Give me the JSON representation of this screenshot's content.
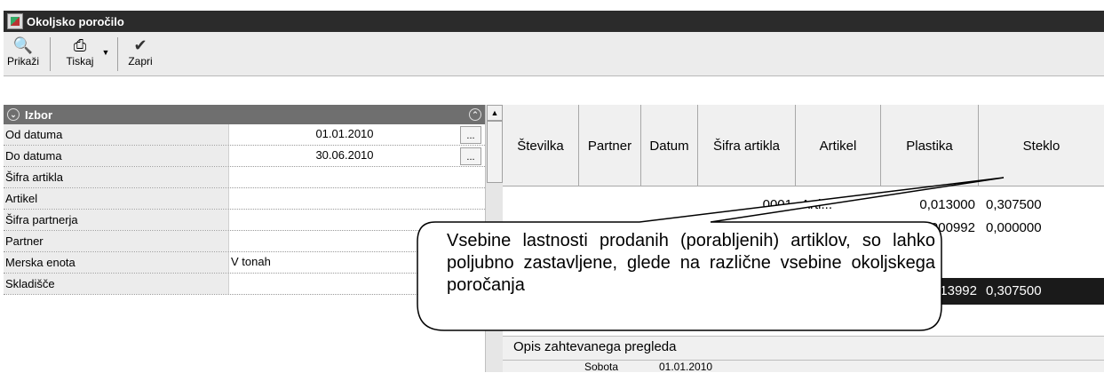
{
  "window": {
    "title": "Okoljsko poročilo"
  },
  "toolbar": {
    "preview_label": "Prikaži",
    "print_label": "Tiskaj",
    "close_label": "Zapri"
  },
  "panel": {
    "title": "Izbor",
    "rows": [
      {
        "label": "Od datuma",
        "value": "01.01.2010"
      },
      {
        "label": "Do datuma",
        "value": "30.06.2010"
      },
      {
        "label": "Šifra artikla",
        "value": ""
      },
      {
        "label": "Artikel",
        "value": ""
      },
      {
        "label": "Šifra partnerja",
        "value": ""
      },
      {
        "label": "Partner",
        "value": ""
      },
      {
        "label": "Merska enota",
        "value": "V tonah"
      },
      {
        "label": "Skladišče",
        "value": ""
      }
    ]
  },
  "grid": {
    "columns": [
      "Številka",
      "Partner",
      "Datum",
      "Šifra artikla",
      "Artikel",
      "Plastika",
      "Steklo"
    ],
    "rows": [
      {
        "sifra": "0001",
        "artikel": "Arti...",
        "plastika": "0,013000",
        "steklo": "0,307500"
      },
      {
        "sifra": "",
        "artikel": "",
        "plastika": "0,000992",
        "steklo": "0,000000"
      }
    ],
    "totals": {
      "plastika": "0,013992",
      "steklo": "0,307500"
    },
    "extra_partial": {
      "c1": "Sobota",
      "c2": "01.01.2010"
    }
  },
  "opis": {
    "title": "Opis zahtevanega pregleda"
  },
  "callout": {
    "text": "Vsebine lastnosti prodanih (porabljenih) artiklov, so lahko poljubno zastavljene, glede na različne vsebine okoljskega poročanja"
  }
}
